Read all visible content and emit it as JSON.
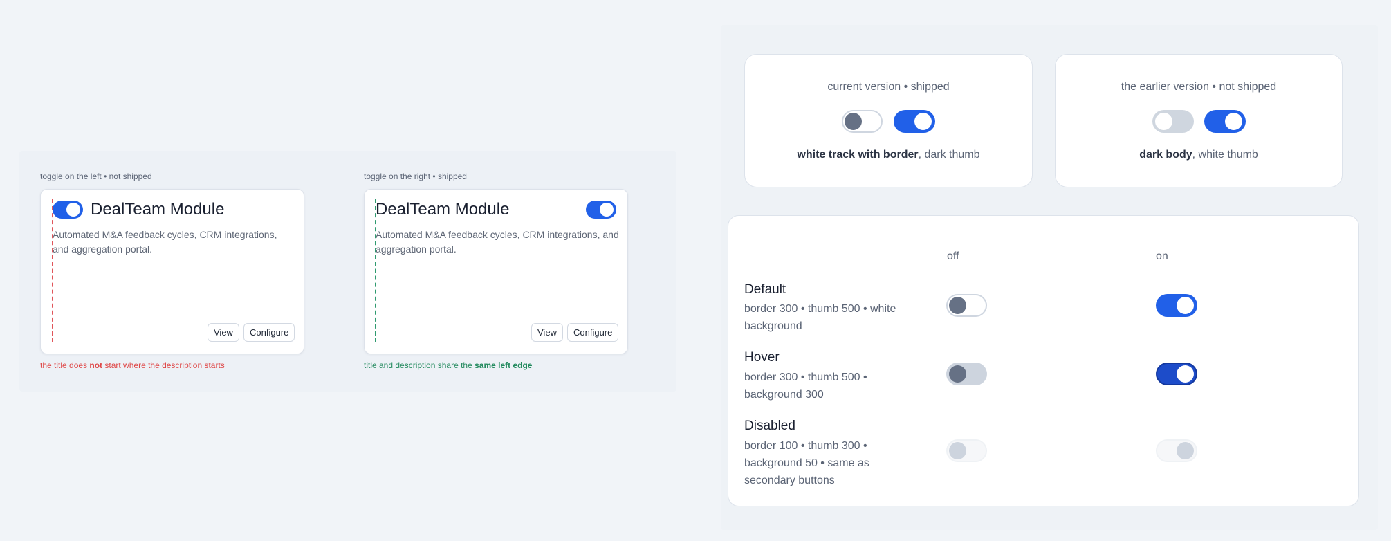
{
  "left_demo": {
    "bad": {
      "caption": "toggle on the left • not shipped",
      "card": {
        "title": "DealTeam Module",
        "description": "Automated M&A feedback cycles, CRM integrations, and aggregation portal.",
        "view_label": "View",
        "configure_label": "Configure",
        "toggle_on": true
      },
      "note_a": "the title does ",
      "note_b": "not",
      "note_c": " start where the description starts"
    },
    "good": {
      "caption": "toggle on the right • shipped",
      "card": {
        "title": "DealTeam Module",
        "description": "Automated M&A feedback cycles, CRM integrations, and aggregation portal.",
        "view_label": "View",
        "configure_label": "Configure",
        "toggle_on": true
      },
      "note_a": "title and description share the ",
      "note_b": "same left edge"
    }
  },
  "versions": {
    "current": {
      "caption": "current version • shipped",
      "desc_bold": "white track with border",
      "desc_rest": ", dark thumb"
    },
    "earlier": {
      "caption": "the earlier version • not shipped",
      "desc_bold": "dark body",
      "desc_rest": ", white thumb"
    }
  },
  "states": {
    "col_off": "off",
    "col_on": "on",
    "rows": [
      {
        "name": "Default",
        "desc": "border 300 • thumb 500 • white background"
      },
      {
        "name": "Hover",
        "desc": "border 300 • thumb 500 • background 300"
      },
      {
        "name": "Disabled",
        "desc": "border 100 • thumb 300 • background 50 • same as secondary buttons"
      }
    ]
  },
  "colors": {
    "accent": "#2160e8",
    "accent_hover": "#1d4cc9",
    "error_note": "#df4848",
    "success_note": "#238a5e"
  }
}
